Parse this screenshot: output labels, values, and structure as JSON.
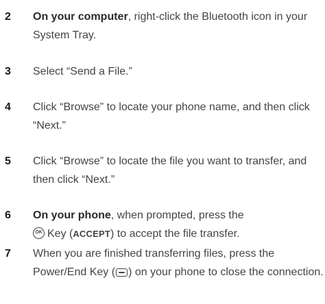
{
  "steps": [
    {
      "number": "2",
      "bold_lead": "On your computer",
      "text": ", right-click the Bluetooth icon in your System Tray."
    },
    {
      "number": "3",
      "text": "Select “Send a File.”"
    },
    {
      "number": "4",
      "text": "Click “Browse” to locate your phone name, and then click “Next.”"
    },
    {
      "number": "5",
      "text": "Click “Browse” to locate the file you want to transfer, and then click “Next.”"
    },
    {
      "number": "6",
      "bold_lead": "On your phone",
      "text_a": ", when prompted, press the",
      "ok_icon_text": "OK",
      "text_b": "Key (",
      "accept_label": "ACCEPT",
      "text_c": ") to accept the file transfer."
    },
    {
      "number": "7",
      "text_a": "When you are finished transferring files, press the Power/End Key (",
      "text_b": ") on your phone to close the connection."
    }
  ],
  "icons": {
    "ok_key": "ok-key-icon",
    "power_end_key": "power-end-key-icon"
  }
}
